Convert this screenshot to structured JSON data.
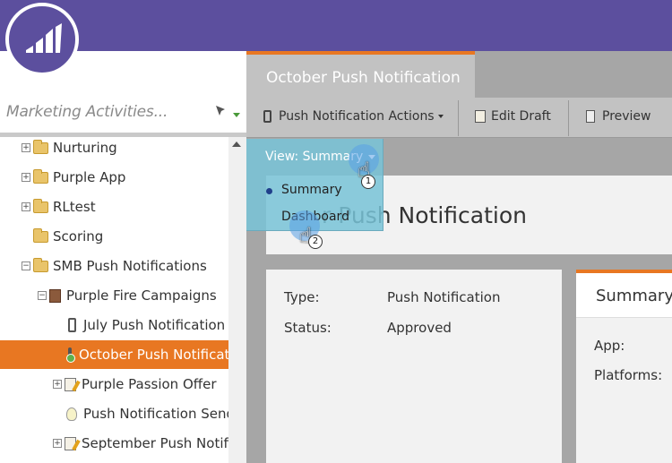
{
  "search": {
    "placeholder": "Marketing Activities..."
  },
  "tree": {
    "items": [
      {
        "label": "Nurturing"
      },
      {
        "label": "Purple App"
      },
      {
        "label": "RLtest"
      },
      {
        "label": "Scoring"
      },
      {
        "label": "SMB Push Notifications"
      },
      {
        "label": "Purple Fire Campaigns"
      },
      {
        "label": "July Push Notification"
      },
      {
        "label": "October Push Notificat"
      },
      {
        "label": "Purple Passion Offer"
      },
      {
        "label": "Push Notification Send"
      },
      {
        "label": "September Push Notifi"
      }
    ]
  },
  "tab": {
    "title": "October Push Notification"
  },
  "toolbar": {
    "actions_label": "Push Notification Actions",
    "edit_label": "Edit Draft",
    "preview_label": "Preview"
  },
  "dropdown": {
    "header": "View: Summary",
    "items": [
      "Summary",
      "Dashboard"
    ]
  },
  "content": {
    "title_fragment": "r Push Notification"
  },
  "details": {
    "type_label": "Type:",
    "type_value": "Push Notification",
    "status_label": "Status:",
    "status_value": "Approved"
  },
  "summary_card": {
    "title": "Summary",
    "app_label": "App:",
    "platforms_label": "Platforms:"
  },
  "steps": [
    "1",
    "2"
  ],
  "colors": {
    "header_purple": "#5c4f9e",
    "accent_orange": "#e87722",
    "dropdown_teal": "#78c3d7"
  }
}
